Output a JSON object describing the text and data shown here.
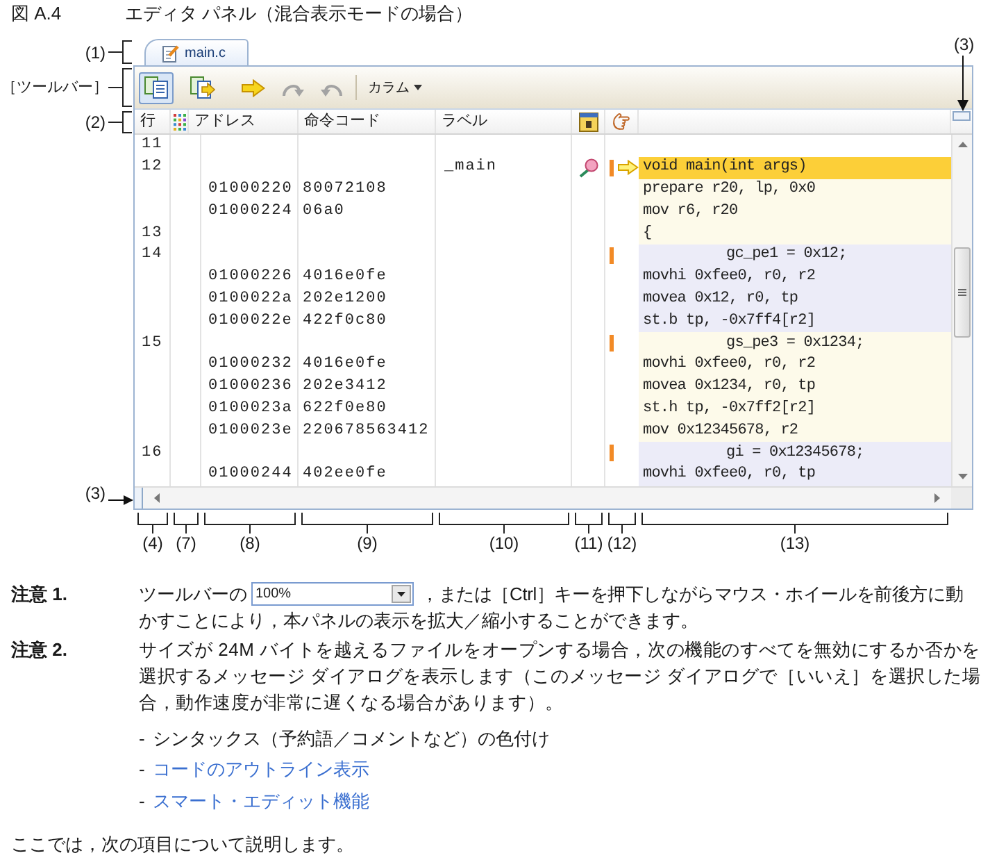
{
  "figure": {
    "number": "図 A.4",
    "title": "エディタ パネル（混合表示モードの場合）"
  },
  "callouts": {
    "tab": "(1)",
    "toolbar": "［ツールバー］",
    "header": "(2)",
    "splitter_top": "(3)",
    "splitter_left": "(3)"
  },
  "editor": {
    "tab": {
      "label": "main.c",
      "selected": true
    },
    "toolbar": {
      "buttons": [
        {
          "kind": "mixed",
          "selected": true,
          "disabled": false
        },
        {
          "kind": "jump",
          "selected": false,
          "disabled": false
        },
        {
          "kind": "go",
          "selected": false,
          "disabled": false
        },
        {
          "kind": "redo",
          "selected": false,
          "disabled": true
        },
        {
          "kind": "undo",
          "selected": false,
          "disabled": true
        }
      ],
      "column_menu": "カラム"
    },
    "columns": [
      {
        "kind": "text",
        "label": "行"
      },
      {
        "kind": "grid"
      },
      {
        "kind": "text",
        "label": "アドレス"
      },
      {
        "kind": "text",
        "label": "命令コード"
      },
      {
        "kind": "text",
        "label": "ラベル"
      },
      {
        "kind": "event"
      },
      {
        "kind": "pointer"
      }
    ],
    "lines": [
      {
        "number": "11",
        "event": false,
        "marker": false,
        "current": false
      },
      {
        "number": "12",
        "kind": "outer",
        "label": "_main",
        "source": "void main(int args)",
        "color": "#fdfaea",
        "event": true,
        "marker": true,
        "current": true,
        "instructions": [
          {
            "address": "01000220",
            "code": "80072108",
            "text": "prepare r20, lp, 0x0"
          },
          {
            "address": "01000224",
            "code": "06a0",
            "text": "mov r6, r20"
          }
        ]
      },
      {
        "number": "13",
        "kind": "outer",
        "source": "{",
        "color": "#fdfaea",
        "event": false,
        "marker": false,
        "current": false
      },
      {
        "number": "14",
        "kind": "inner",
        "source": "gc_pe1 = 0x12;",
        "color": "#ececf8",
        "event": false,
        "marker": true,
        "current": false,
        "instructions": [
          {
            "address": "01000226",
            "code": "4016e0fe",
            "text": "movhi 0xfee0, r0, r2"
          },
          {
            "address": "0100022a",
            "code": "202e1200",
            "text": "movea 0x12, r0, tp"
          },
          {
            "address": "0100022e",
            "code": "422f0c80",
            "text": "st.b tp, -0x7ff4[r2]"
          }
        ]
      },
      {
        "number": "15",
        "kind": "inner",
        "source": "gs_pe3 = 0x1234;",
        "color": "#fdfaea",
        "event": false,
        "marker": true,
        "current": false,
        "instructions": [
          {
            "address": "01000232",
            "code": "4016e0fe",
            "text": "movhi 0xfee0, r0, r2"
          },
          {
            "address": "01000236",
            "code": "202e3412",
            "text": "movea 0x1234, r0, tp"
          },
          {
            "address": "0100023a",
            "code": "622f0e80",
            "text": "st.h tp, -0x7ff2[r2]"
          },
          {
            "address": "0100023e",
            "code": "220678563412",
            "text": "mov 0x12345678, r2"
          }
        ]
      },
      {
        "number": "16",
        "kind": "inner",
        "source": "gi = 0x12345678;",
        "color": "#ececf8",
        "event": false,
        "marker": true,
        "current": false,
        "instructions": [
          {
            "address": "01000244",
            "code": "402ee0fe",
            "text": "movhi 0xfee0, r0, tp"
          }
        ]
      }
    ]
  },
  "column_callouts": [
    "(4)",
    "(7)",
    "(8)",
    "(9)",
    "(10)",
    "(11)",
    "(12)",
    "(13)"
  ],
  "note_1": {
    "label": "注意 1.",
    "lead": "ツールバーの",
    "zoom_box": {
      "value": "100%"
    },
    "rest": "，または［Ctrl］キーを押下しながらマウス・ホイールを前後方に動",
    "continuation": "かすことにより，本パネルの表示を拡大／縮小することができます。"
  },
  "note_2": {
    "label": "注意 2.",
    "text": "サイズが 24M バイトを越えるファイルをオープンする場合，次の機能のすべてを無効にするか否かを選択するメッセージ ダイアログを表示します（このメッセージ ダイアログで［いいえ］を選択した場合，動作速度が非常に遅くなる場合があります）。",
    "items": [
      {
        "marker": "-",
        "text": "シンタックス（予約語／コメントなど）の色付け",
        "link": false
      },
      {
        "marker": "-",
        "text": "コードのアウトライン表示",
        "link": true
      },
      {
        "marker": "-",
        "text": "スマート・エディット機能",
        "link": true
      }
    ]
  },
  "closing": "ここでは，次の項目について説明します。"
}
